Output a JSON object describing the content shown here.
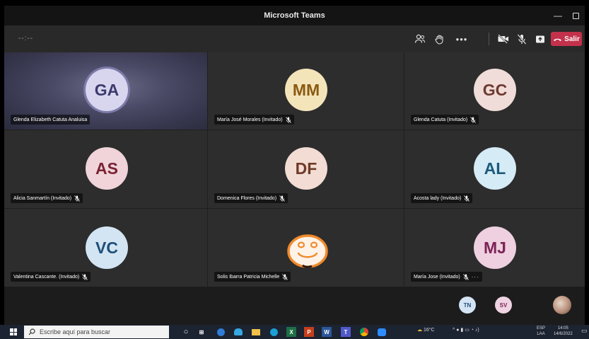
{
  "window": {
    "title": "Microsoft Teams"
  },
  "toolbar": {
    "timer": "--:--",
    "leave_label": "Salir"
  },
  "participants": [
    {
      "initials": "GA",
      "name": "Glenda Elizabeth Catuta Analuisa",
      "muted": false
    },
    {
      "initials": "MM",
      "name": "María José Morales (Invitado)",
      "muted": true
    },
    {
      "initials": "GC",
      "name": "Glenda Catuta (Invitado)",
      "muted": true
    },
    {
      "initials": "AS",
      "name": "Alicia Sanmartín (Invitado)",
      "muted": true
    },
    {
      "initials": "DF",
      "name": "Domenica Flores (Invitado)",
      "muted": true
    },
    {
      "initials": "AL",
      "name": "Acosta lady (Invitado)",
      "muted": true
    },
    {
      "initials": "VC",
      "name": "Valentina Cascante. (Invitado)",
      "muted": true
    },
    {
      "initials": "",
      "name": "Solis Ibarra Patricia Michelle",
      "muted": true
    },
    {
      "initials": "MJ",
      "name": "María Jose (Invitado)",
      "muted": true
    }
  ],
  "strip": [
    {
      "initials": "TN"
    },
    {
      "initials": "SV"
    }
  ],
  "taskbar": {
    "search_placeholder": "Escribe aquí para buscar",
    "weather": "16°C",
    "lang": "ESP",
    "lang2": "LAA",
    "time": "14:05",
    "date": "14/6/2022"
  },
  "colors": {
    "leave": "#c4314b",
    "GA": "#d8d6ef",
    "MM": "#f4e4ba",
    "GC": "#f0dcd8",
    "AS": "#f0d4d9",
    "DF": "#f2dcd4",
    "AL": "#d5ebf6",
    "VC": "#d3e5f3",
    "MJ": "#eed0e0",
    "GA_fg": "#3c3a6c",
    "MM_fg": "#8a5a12",
    "GC_fg": "#6e3a30",
    "AS_fg": "#7a2233",
    "DF_fg": "#6e3a28",
    "AL_fg": "#1d5a7c",
    "VC_fg": "#1f4f78",
    "MJ_fg": "#7c2456"
  }
}
